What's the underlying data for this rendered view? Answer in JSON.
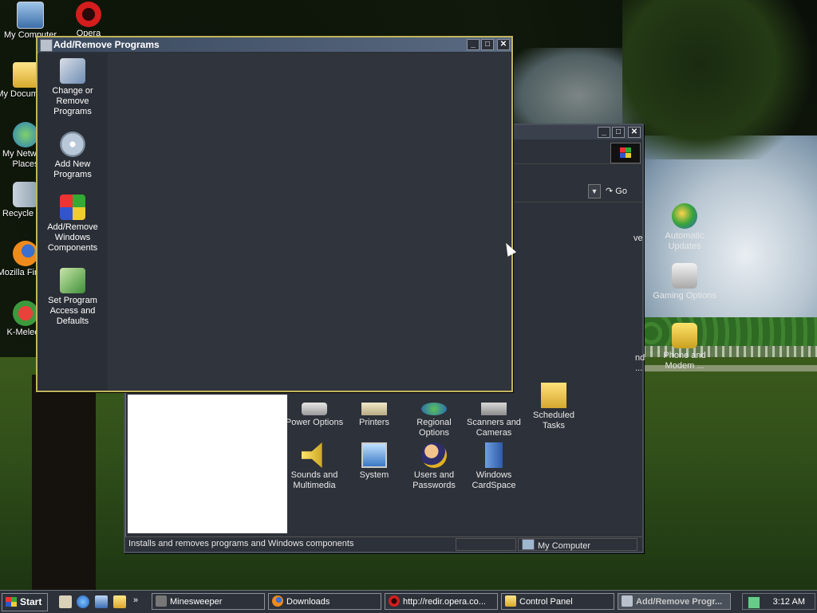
{
  "desktop": {
    "icons": [
      {
        "label": "My Computer",
        "icon": "my-computer-icon"
      },
      {
        "label": "Opera",
        "icon": "opera-icon"
      },
      {
        "label": "My Documents",
        "icon": "my-documents-icon"
      },
      {
        "label": "My Network Places",
        "icon": "network-places-icon"
      },
      {
        "label": "Recycle Bin",
        "icon": "recycle-bin-icon"
      },
      {
        "label": "Mozilla Firefox",
        "icon": "firefox-icon"
      },
      {
        "label": "K-Meleon",
        "icon": "k-meleon-icon"
      }
    ]
  },
  "add_remove_window": {
    "title": "Add/Remove Programs",
    "sidebar": [
      {
        "label": "Change or Remove Programs",
        "icon": "change-remove-programs-icon"
      },
      {
        "label": "Add New Programs",
        "icon": "add-new-programs-icon"
      },
      {
        "label": "Add/Remove Windows Components",
        "icon": "windows-components-icon"
      },
      {
        "label": "Set Program Access and Defaults",
        "icon": "program-access-icon"
      }
    ]
  },
  "control_panel_window": {
    "go_label": "Go",
    "icons": [
      {
        "label": "Automatic Updates",
        "icon": "automatic-updates-icon"
      },
      {
        "label": "Gaming Options",
        "icon": "gaming-options-icon"
      },
      {
        "label": "Phone and Modem ...",
        "icon": "phone-modem-icon"
      },
      {
        "label": "Power Options",
        "icon": "power-options-icon"
      },
      {
        "label": "Printers",
        "icon": "printers-icon"
      },
      {
        "label": "Regional Options",
        "icon": "regional-options-icon"
      },
      {
        "label": "Scanners and Cameras",
        "icon": "scanners-cameras-icon"
      },
      {
        "label": "Scheduled Tasks",
        "icon": "scheduled-tasks-icon"
      },
      {
        "label": "Sounds and Multimedia",
        "icon": "sounds-multimedia-icon"
      },
      {
        "label": "System",
        "icon": "system-icon"
      },
      {
        "label": "Users and Passwords",
        "icon": "users-passwords-icon"
      },
      {
        "label": "Windows CardSpace",
        "icon": "cardspace-icon"
      }
    ],
    "partial_labels": [
      "ve",
      "nd",
      "..."
    ],
    "status_text": "Installs and removes programs and Windows components",
    "status_location": "My Computer"
  },
  "taskbar": {
    "start_label": "Start",
    "tasks": [
      {
        "label": "Minesweeper",
        "icon": "minesweeper-icon"
      },
      {
        "label": "Downloads",
        "icon": "firefox-icon"
      },
      {
        "label": "http://redir.opera.co...",
        "icon": "opera-icon"
      },
      {
        "label": "Control Panel",
        "icon": "folder-icon"
      },
      {
        "label": "Add/Remove Progr...",
        "icon": "add-remove-icon",
        "active": true
      }
    ],
    "clock": "3:12 AM"
  }
}
